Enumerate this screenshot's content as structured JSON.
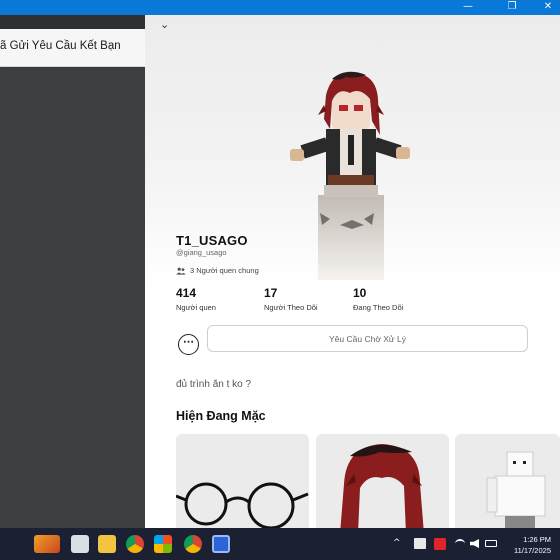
{
  "window": {
    "minimize": "—",
    "maximize": "❐",
    "close": "✕"
  },
  "toast": {
    "text": "ã Gửi Yêu Cầu Kết Bạn"
  },
  "header": {
    "chevron": "⌄"
  },
  "profile": {
    "display_name": "T1_USAGO",
    "handle": "@giang_usago",
    "mutual_friends": "3 Người quen chung",
    "stats": [
      {
        "value": "414",
        "label": "Người quen"
      },
      {
        "value": "17",
        "label": "Người Theo Dõi"
      },
      {
        "value": "10",
        "label": "Đang Theo Dõi"
      }
    ],
    "more_button": "⋯",
    "pending_button": "Yêu Cầu Chờ Xử Lý",
    "bio": "đủ trình ăn t ko ?"
  },
  "wearing": {
    "title": "Hiện Đang Mặc",
    "items": [
      {
        "icon": "glasses-item-icon"
      },
      {
        "icon": "red-hair-item-icon"
      },
      {
        "icon": "blocky-avatar-item-icon"
      }
    ]
  },
  "taskbar": {
    "apps": [
      "game-app-icon",
      "window-app-icon",
      "folder-icon",
      "chrome-icon",
      "store-icon",
      "chrome-profile-icon",
      "roblox-icon"
    ],
    "tray_up_arrow": "^",
    "clock_time": "1:26 PM",
    "clock_date": "11/17/2025"
  },
  "colors": {
    "titlebar": "#0a78d6",
    "side_panel": "#3e3f41",
    "taskbar": "#1b2133",
    "hair": "#8a1d1d"
  }
}
